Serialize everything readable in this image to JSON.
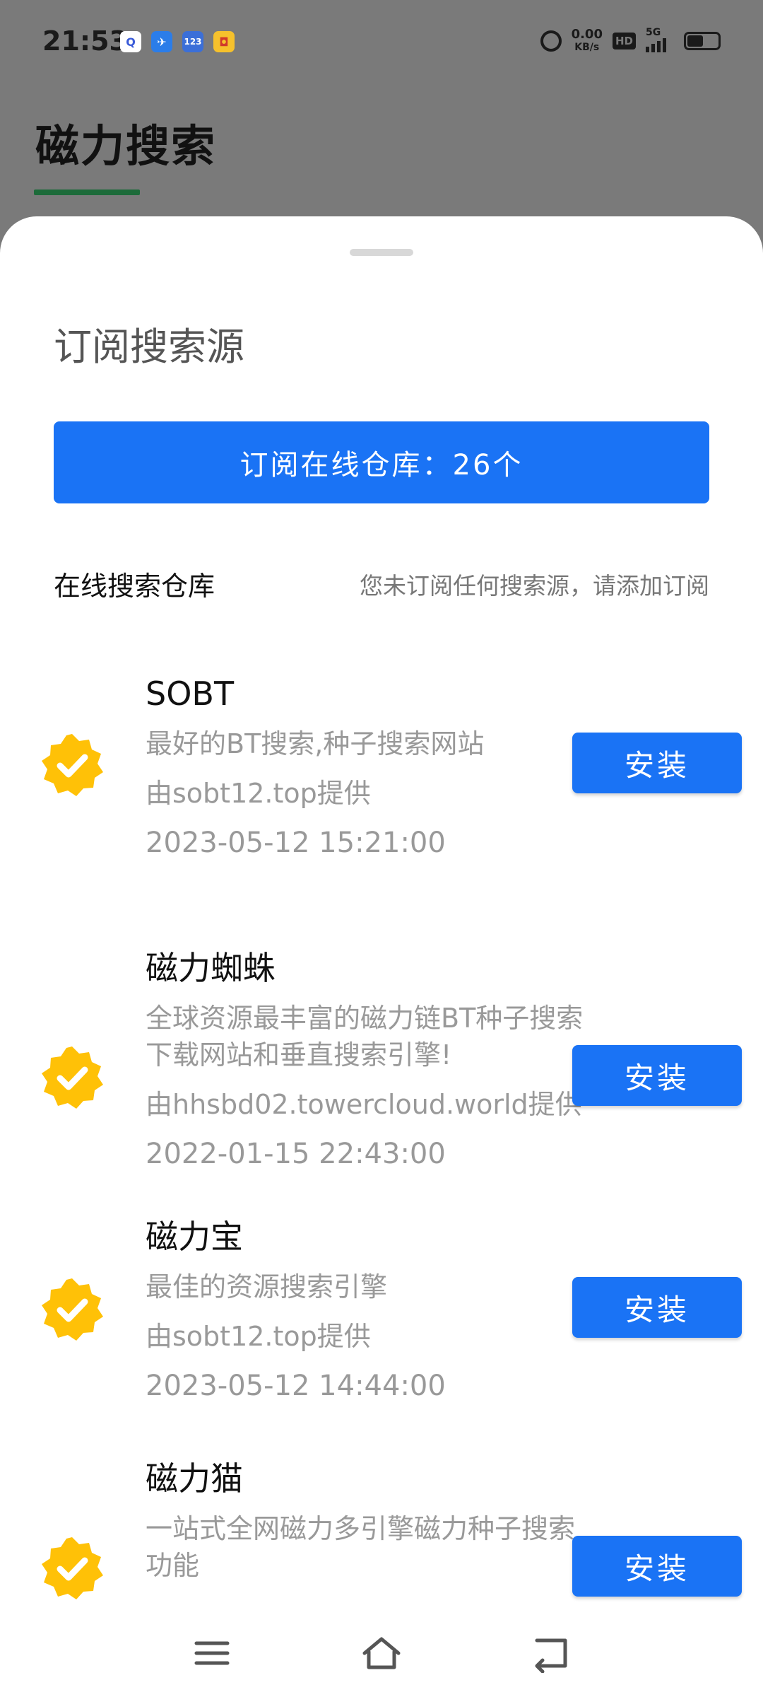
{
  "status_bar": {
    "time": "21:53",
    "notif_icons": [
      {
        "icon": "q-app-icon",
        "text": "Q",
        "color": "#ffffff"
      },
      {
        "icon": "bird-app-icon",
        "text": "✈",
        "color": "#2b7de9"
      },
      {
        "icon": "123-app-icon",
        "text": "123",
        "color": "#3b6fd8"
      },
      {
        "icon": "yellow-app-icon",
        "text": "◘",
        "color": "#f6c12c"
      }
    ],
    "net_speed": "0.00",
    "net_unit": "KB/s",
    "hd_label": "HD",
    "network": "5G"
  },
  "background_app": {
    "title": "磁力搜索"
  },
  "sheet": {
    "title": "订阅搜索源",
    "subscribe_button": "订阅在线仓库：26个",
    "section_label": "在线搜索仓库",
    "section_hint": "您未订阅任何搜索源，请添加订阅",
    "sources": [
      {
        "name": "SOBT",
        "description": "最好的BT搜索,种子搜索网站",
        "provider": "由sobt12.top提供",
        "date": "2023-05-12 15:21:00",
        "install_label": "安装",
        "verified_icon": "verified-check-icon"
      },
      {
        "name": "磁力蜘蛛",
        "description": "全球资源最丰富的磁力链BT种子搜索下载网站和垂直搜索引擎!",
        "provider": "由hhsbd02.towercloud.world提供",
        "date": "2022-01-15 22:43:00",
        "install_label": "安装",
        "verified_icon": "verified-check-icon"
      },
      {
        "name": "磁力宝",
        "description": "最佳的资源搜索引擎",
        "provider": "由sobt12.top提供",
        "date": "2023-05-12 14:44:00",
        "install_label": "安装",
        "verified_icon": "verified-check-icon"
      },
      {
        "name": "磁力猫",
        "description": "一站式全网磁力多引擎磁力种子搜索功能",
        "provider": "",
        "date": "",
        "install_label": "安装",
        "verified_icon": "verified-check-icon"
      }
    ]
  },
  "nav_bar": {
    "menu_icon": "menu-icon",
    "home_icon": "home-icon",
    "back_icon": "back-icon"
  },
  "colors": {
    "primary": "#1a73f5",
    "badge": "#ffc107",
    "accent_underline": "#1d6b3a"
  }
}
